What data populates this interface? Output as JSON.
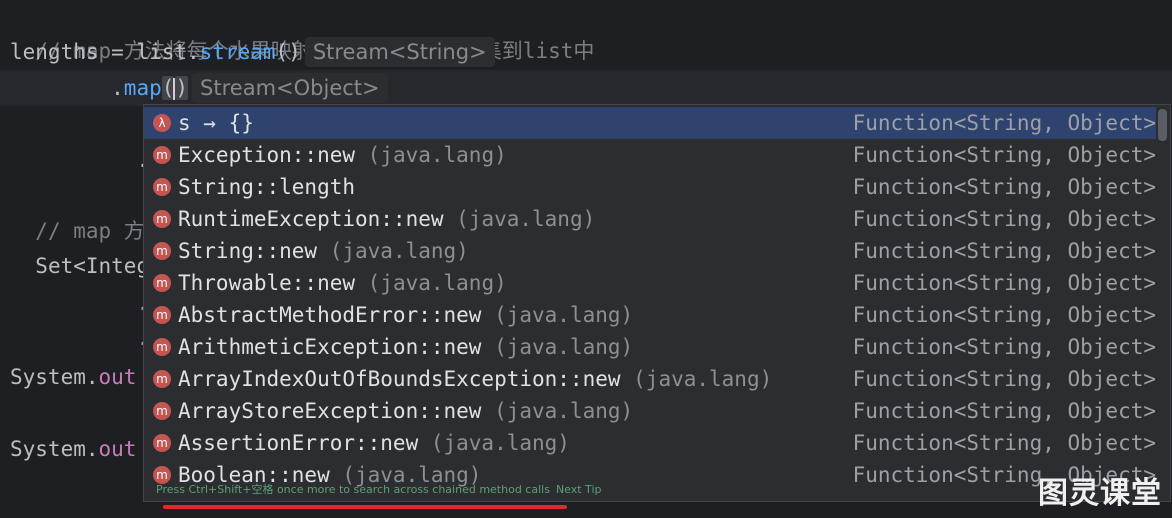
{
  "code": {
    "line1_comment": "// map 方法将每个水果映射为其长度，并将收集到list中",
    "line2_prefix": "lengths = list.",
    "line2_method": "stream",
    "line2_parens": "()",
    "line2_hint": "Stream<String>",
    "line3_indent": "        .",
    "line3_method": "map",
    "line3_open": "(",
    "line3_close": ")",
    "line3_hint": "Stream<Object>",
    "line4_text": "        .co",
    "line5_comment": "// map 方法",
    "line6_text": "Set<Integer",
    "line7_text": "        .ma",
    "line8_text": "        .co",
    "line9_prefix": "System.",
    "line9_field": "out",
    "line10_prefix": "System.",
    "line10_field": "out"
  },
  "completion": {
    "items": [
      {
        "icon": "λ",
        "name": "s → {}",
        "qualifier": "",
        "type": "Function<String, Object>",
        "selected": true
      },
      {
        "icon": "m",
        "name": "Exception::new",
        "qualifier": " (java.lang)",
        "type": "Function<String, Object>"
      },
      {
        "icon": "m",
        "name": "String::length",
        "qualifier": "",
        "type": "Function<String, Object>"
      },
      {
        "icon": "m",
        "name": "RuntimeException::new",
        "qualifier": " (java.lang)",
        "type": "Function<String, Object>"
      },
      {
        "icon": "m",
        "name": "String::new",
        "qualifier": " (java.lang)",
        "type": "Function<String, Object>"
      },
      {
        "icon": "m",
        "name": "Throwable::new",
        "qualifier": " (java.lang)",
        "type": "Function<String, Object>"
      },
      {
        "icon": "m",
        "name": "AbstractMethodError::new",
        "qualifier": " (java.lang)",
        "type": "Function<String, Object>"
      },
      {
        "icon": "m",
        "name": "ArithmeticException::new",
        "qualifier": " (java.lang)",
        "type": "Function<String, Object>"
      },
      {
        "icon": "m",
        "name": "ArrayIndexOutOfBoundsException::new",
        "qualifier": " (java.lang)",
        "type": "Function<String, Object>"
      },
      {
        "icon": "m",
        "name": "ArrayStoreException::new",
        "qualifier": " (java.lang)",
        "type": "Function<String, Object>"
      },
      {
        "icon": "m",
        "name": "AssertionError::new",
        "qualifier": " (java.lang)",
        "type": "Function<String, Object>"
      },
      {
        "icon": "m",
        "name": "Boolean::new",
        "qualifier": " (java.lang)",
        "type": "Function<String, Object>"
      }
    ],
    "footer_text": "Press Ctrl+Shift+空格 once more to search across chained method calls",
    "footer_link": "Next Tip"
  },
  "watermark": "图灵课堂",
  "colors": {
    "background": "#1e1f22",
    "popup": "#2b2d30",
    "selection": "#2e436e",
    "method": "#56a8f5",
    "field": "#c77dbb",
    "underline": "#e0282e"
  }
}
